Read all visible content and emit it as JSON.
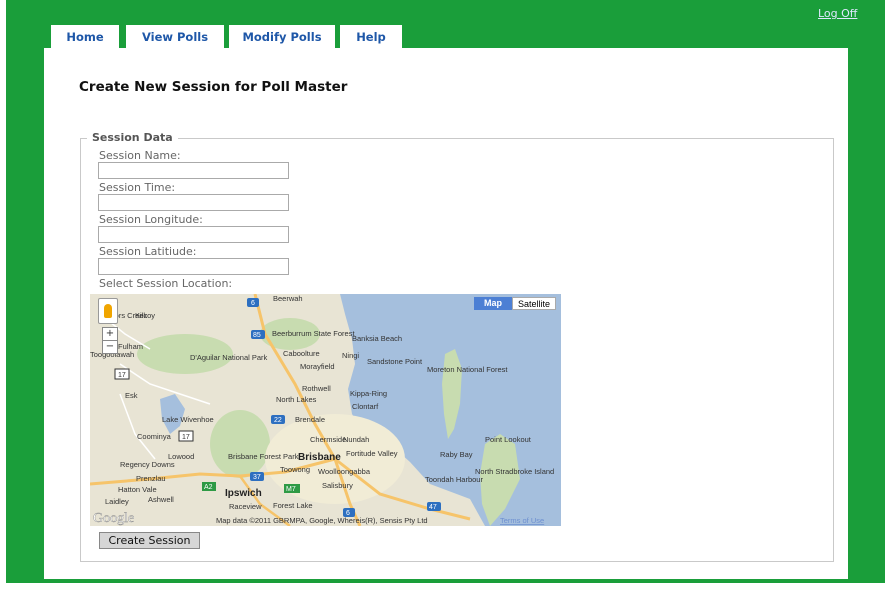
{
  "nav": {
    "tabs": [
      {
        "label": "Home"
      },
      {
        "label": "View Polls"
      },
      {
        "label": "Modify Polls"
      },
      {
        "label": "Help"
      }
    ],
    "logoff_label": "Log Off"
  },
  "page": {
    "title": "Create New Session for Poll Master"
  },
  "session_form": {
    "legend": "Session Data",
    "fields": [
      {
        "label": "Session Name:",
        "value": ""
      },
      {
        "label": "Session Time:",
        "value": ""
      },
      {
        "label": "Session Longitude:",
        "value": ""
      },
      {
        "label": "Session Latitiude:",
        "value": ""
      }
    ],
    "location_label": "Select Session Location:",
    "submit_label": "Create Session"
  },
  "map": {
    "type_buttons": {
      "map": "Map",
      "satellite": "Satellite"
    },
    "zoom": {
      "in": "+",
      "out": "−"
    },
    "attribution": "Map data ©2011 GBRMPA, Google, Whereis(R), Sensis Pty Ltd",
    "terms_link": "Terms of Use",
    "google_logo": "Google",
    "places": [
      "Beerwah",
      "Gregors Creek",
      "Kilcoy",
      "Fulham",
      "Toogoolawah",
      "D'Aguilar National Park",
      "Beerburrum State Forest",
      "Caboolture",
      "Banksia Beach",
      "Ningi",
      "Sandstone Point",
      "Morayfield",
      "Moreton National Forest",
      "Esk",
      "Rothwell",
      "North Lakes",
      "Kippa-Ring",
      "Clontarf",
      "Lake Wivenhoe",
      "Brendale",
      "Coominya",
      "Chermside",
      "Nundah",
      "Point Lookout",
      "Lowood",
      "Brisbane Forest Park",
      "Brisbane",
      "Fortitude Valley",
      "Toowong",
      "Woolloongabba",
      "Raby Bay",
      "Regency Downs",
      "Prenzlau",
      "North Stradbroke Island",
      "Salisbury",
      "Toondah Harbour",
      "Hatton Vale",
      "Ipswich",
      "Laidley",
      "Ashwell",
      "Raceview",
      "Forest Lake"
    ],
    "route_shields": [
      "6",
      "85",
      "17",
      "22",
      "17",
      "37",
      "M7",
      "A2",
      "6",
      "47"
    ],
    "colors": {
      "land": "#e8e4d4",
      "water": "#a5bfdd",
      "park": "#c8dcb0",
      "urban": "#f1ecd6",
      "road_major": "#f6c46a",
      "road_minor": "#ffffff"
    }
  },
  "colors": {
    "background": "#1a9e3a",
    "tab_text": "#1e57a8",
    "panel": "#ffffff"
  }
}
